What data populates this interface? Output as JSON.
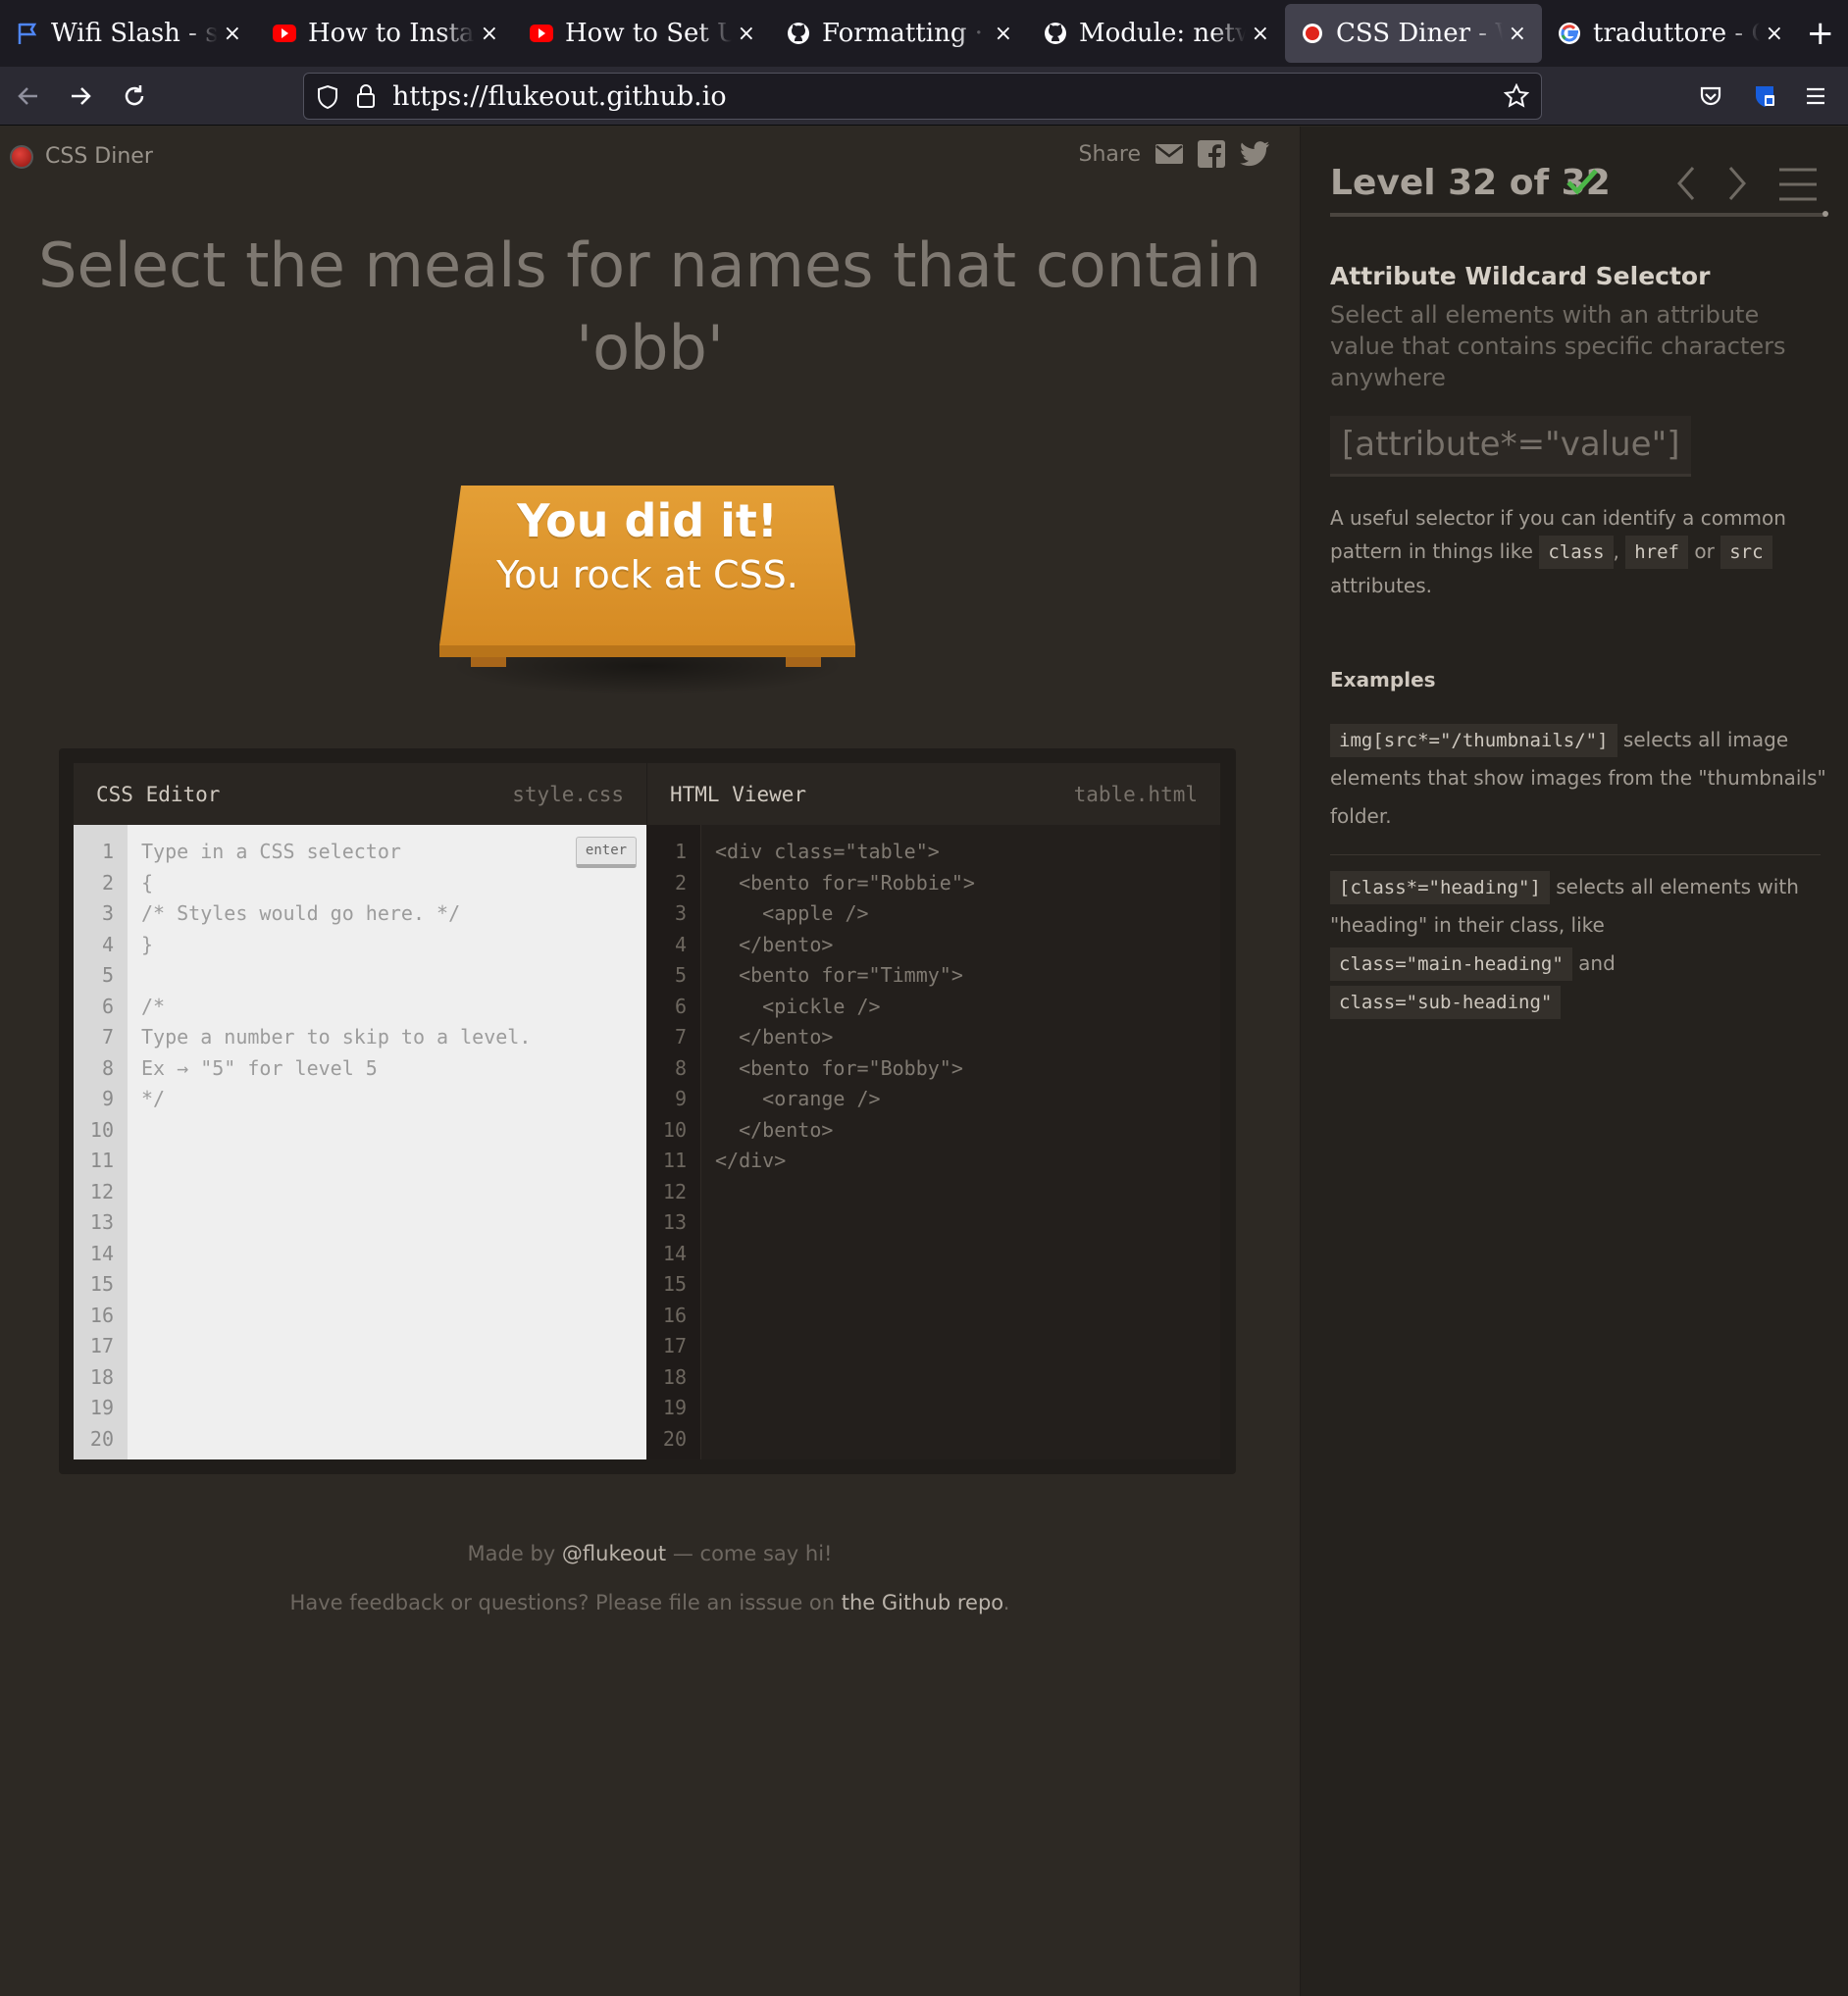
{
  "browser": {
    "tabs": [
      {
        "title": "Wifi Slash - sol",
        "icon": "flag-icon",
        "active": false
      },
      {
        "title": "How to Install",
        "icon": "youtube-icon",
        "active": false
      },
      {
        "title": "How to Set Up",
        "icon": "youtube-icon",
        "active": false
      },
      {
        "title": "Formatting · p",
        "icon": "github-icon",
        "active": false
      },
      {
        "title": "Module: netw",
        "icon": "github-icon",
        "active": false
      },
      {
        "title": "CSS Diner - W",
        "icon": "css-diner-icon",
        "active": true
      },
      {
        "title": "traduttore - Go",
        "icon": "google-icon",
        "active": false
      }
    ],
    "close_glyph": "×",
    "new_tab_glyph": "+",
    "url": "https://flukeout.github.io"
  },
  "app": {
    "name": "CSS Diner",
    "share_label": "Share",
    "headline": "Select the meals for names that contain 'obb'",
    "success_line1": "You did it!",
    "success_line2": "You rock at CSS.",
    "colors": {
      "table": "#d8912a",
      "check": "#4cb648",
      "background": "#2d2924",
      "sidebar": "#25221e"
    }
  },
  "editor": {
    "css_title": "CSS Editor",
    "css_file": "style.css",
    "html_title": "HTML Viewer",
    "html_file": "table.html",
    "enter_label": "enter",
    "line_numbers": [
      "1",
      "2",
      "3",
      "4",
      "5",
      "6",
      "7",
      "8",
      "9",
      "10",
      "11",
      "12",
      "13",
      "14",
      "15",
      "16",
      "17",
      "18",
      "19",
      "20"
    ],
    "css_lines": [
      "Type in a CSS selector",
      "{",
      "/* Styles would go here. */",
      "}",
      "",
      "/*",
      "Type a number to skip to a level.",
      "Ex → \"5\" for level 5",
      "*/"
    ],
    "html_lines": [
      "<div class=\"table\">",
      "  <bento for=\"Robbie\">",
      "    <apple />",
      "  </bento>",
      "  <bento for=\"Timmy\">",
      "    <pickle />",
      "  </bento>",
      "  <bento for=\"Bobby\">",
      "    <orange />",
      "  </bento>",
      "</div>"
    ]
  },
  "footer": {
    "made_by_prefix": "Made by ",
    "made_by_link": "@flukeout",
    "made_by_suffix": " — come say hi!",
    "feedback_prefix": "Have feedback or questions? Please file an isssue on ",
    "feedback_link": "the Github repo",
    "feedback_suffix": "."
  },
  "sidebar": {
    "level_text": "Level 32 of 32",
    "level_completed": true,
    "selector_name": "Attribute Wildcard Selector",
    "selector_title": "Select all elements with an attribute value that contains specific characters anywhere",
    "syntax": "[attribute*=\"value\"]",
    "hint_prefix": "A useful selector if you can identify a common pattern in things like",
    "hint_chip1": "class",
    "hint_sep": ",",
    "hint_chip2": "href",
    "hint_or": "or",
    "hint_chip3": "src",
    "hint_suffix": "attributes.",
    "examples_title": "Examples",
    "ex1_code": "img[src*=\"/thumbnails/\"]",
    "ex1_text": "selects all image elements that show images from the \"thumbnails\" folder.",
    "ex2_code": "[class*=\"heading\"]",
    "ex2_text": "selects all elements with \"heading\" in their class, like",
    "ex2_chip1": "class=\"main-heading\"",
    "ex2_and": "and",
    "ex2_chip2": "class=\"sub-heading\""
  }
}
